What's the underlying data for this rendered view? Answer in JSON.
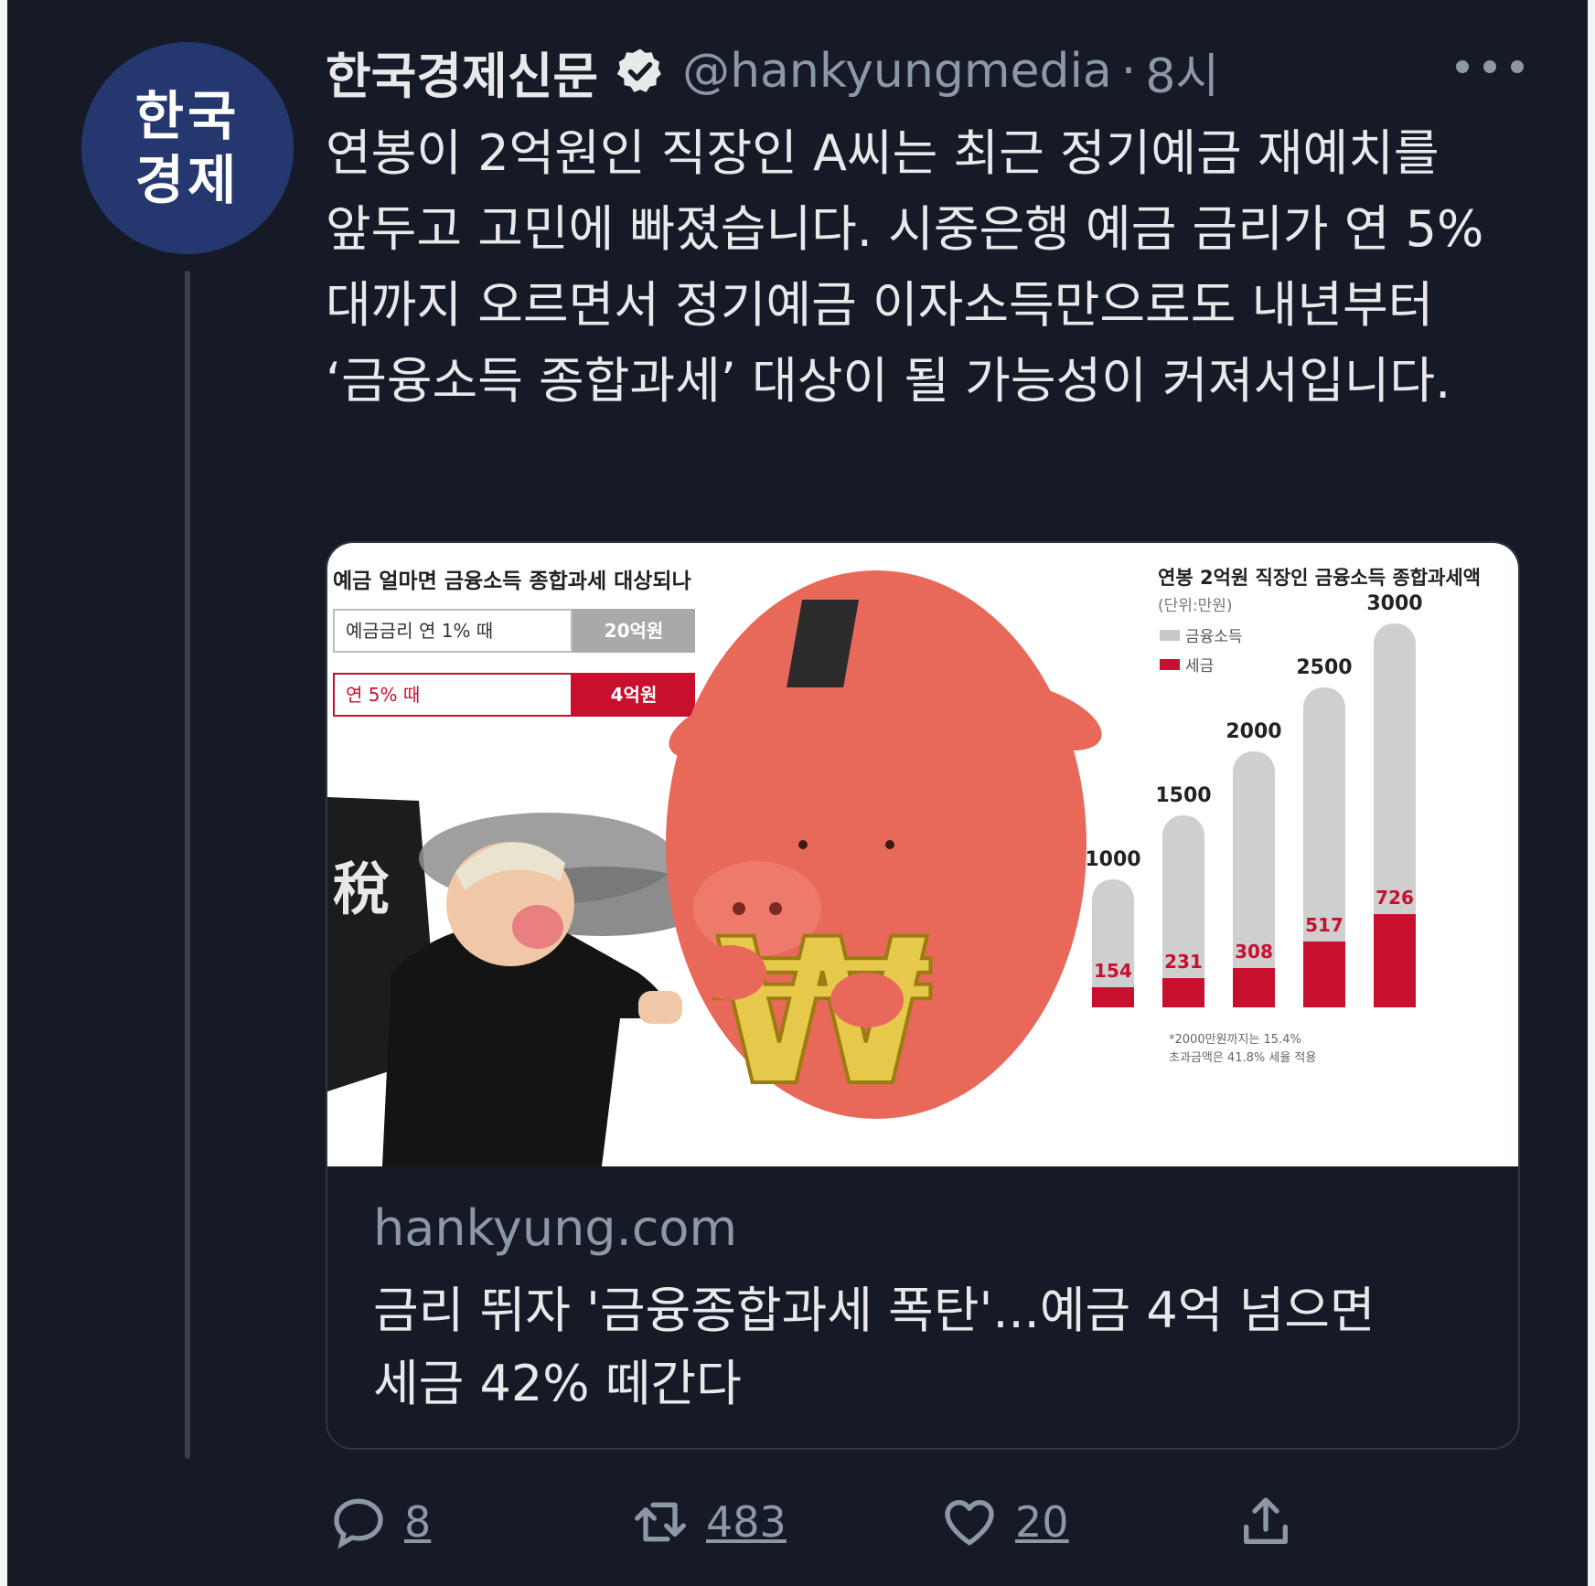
{
  "avatar": {
    "text": "한국 경제"
  },
  "header": {
    "display_name": "한국경제신문",
    "handle": "@hankyungmedia",
    "separator": "·",
    "time": "8시"
  },
  "tweet": {
    "text": "연봉이 2억원인 직장인 A씨는 최근 정기예금 재예치를 앞두고 고민에 빠졌습니다. 시중은행 예금 금리가 연 5%대까지 오르면서 정기예금 이자소득만으로도 내년부터 ‘금융소득 종합과세’ 대상이 될 가능성이 커져서입니다."
  },
  "card": {
    "domain": "hankyung.com",
    "title": "금리 뛰자 '금융종합과세 폭탄'...예금 4억 넘으면 세금 42% 떼간다",
    "infographic": {
      "left_title": "예금 얼마면 금융소득 종합과세 대상되나",
      "rows": [
        {
          "label": "예금금리 연 1% 때",
          "value": "20억원"
        },
        {
          "label": "연 5% 때",
          "value": "4억원"
        }
      ],
      "tax_char": "稅",
      "won_char": "₩",
      "right_title": "연봉 2억원 직장인 금융소득 종합과세액",
      "unit": "(단위:만원)",
      "legend": [
        "금융소득",
        "세금"
      ],
      "footnote": [
        "*2000만원까지는 15.4%",
        "초과금액은 41.8% 세율 적용"
      ]
    }
  },
  "chart_data": {
    "type": "bar",
    "title": "연봉 2억원 직장인 금융소득 종합과세액",
    "ylabel": "(단위:만원)",
    "categories": [
      "",
      "",
      "",
      "",
      ""
    ],
    "series": [
      {
        "name": "금융소득",
        "values": [
          1000,
          1500,
          2000,
          2500,
          3000
        ]
      },
      {
        "name": "세금",
        "values": [
          154,
          231,
          308,
          517,
          726
        ]
      }
    ],
    "ylim": [
      0,
      3000
    ]
  },
  "actions": {
    "reply_count": "8",
    "retweet_count": "483",
    "like_count": "20"
  },
  "colors": {
    "background": "#151a26",
    "avatar": "#24386f",
    "accent_red": "#c8102e",
    "muted": "#8b98a5"
  }
}
